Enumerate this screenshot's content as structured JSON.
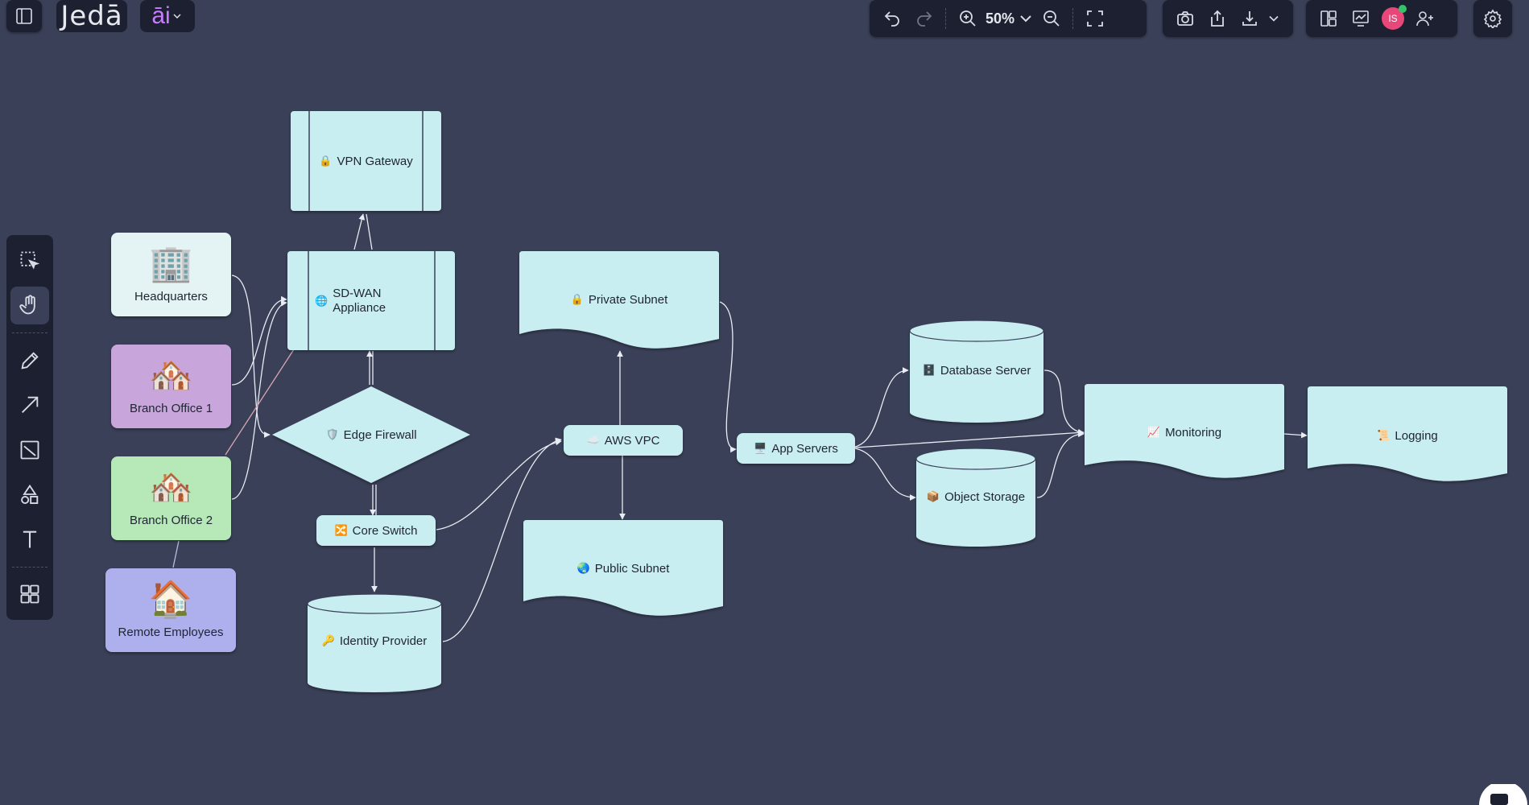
{
  "app": {
    "logo": "Jedā",
    "ai_label": "āi",
    "zoom": "50%",
    "avatar_initials": "IS"
  },
  "colors": {
    "canvas": "#3a4058",
    "toolbar": "#1c2030",
    "node_fill": "#c8eef2",
    "headquarters": "#e4f4f4",
    "branch1": "#c8a6dc",
    "branch2": "#b6e8b8",
    "remote": "#aeb0ee"
  },
  "diagram": {
    "headquarters": "Headquarters",
    "branch_office_1": "Branch Office 1",
    "branch_office_2": "Branch Office 2",
    "remote_employees": "Remote Employees",
    "vpn_gateway": "VPN Gateway",
    "sdwan_line1": "SD-WAN",
    "sdwan_line2": "Appliance",
    "edge_firewall": "Edge Firewall",
    "core_switch": "Core Switch",
    "identity_provider": "Identity Provider",
    "private_subnet": "Private Subnet",
    "aws_vpc": "AWS VPC",
    "public_subnet": "Public Subnet",
    "app_servers": "App Servers",
    "database_server": "Database Server",
    "object_storage": "Object Storage",
    "monitoring": "Monitoring",
    "logging": "Logging"
  },
  "icons": {
    "headquarters": "office-building-icon",
    "branch1": "houses-icon",
    "branch2": "houses-icon",
    "remote": "house-icon",
    "vpn": "lock-icon",
    "sdwan": "globe-icon",
    "firewall": "shield-icon",
    "core_switch": "switch-icon",
    "identity": "key-icon",
    "private_subnet": "lock-icon",
    "aws_vpc": "cloud-icon",
    "public_subnet": "globe-icon",
    "app_servers": "computer-icon",
    "database": "cabinet-icon",
    "object_storage": "package-icon",
    "monitoring": "chart-icon",
    "logging": "scroll-icon"
  }
}
